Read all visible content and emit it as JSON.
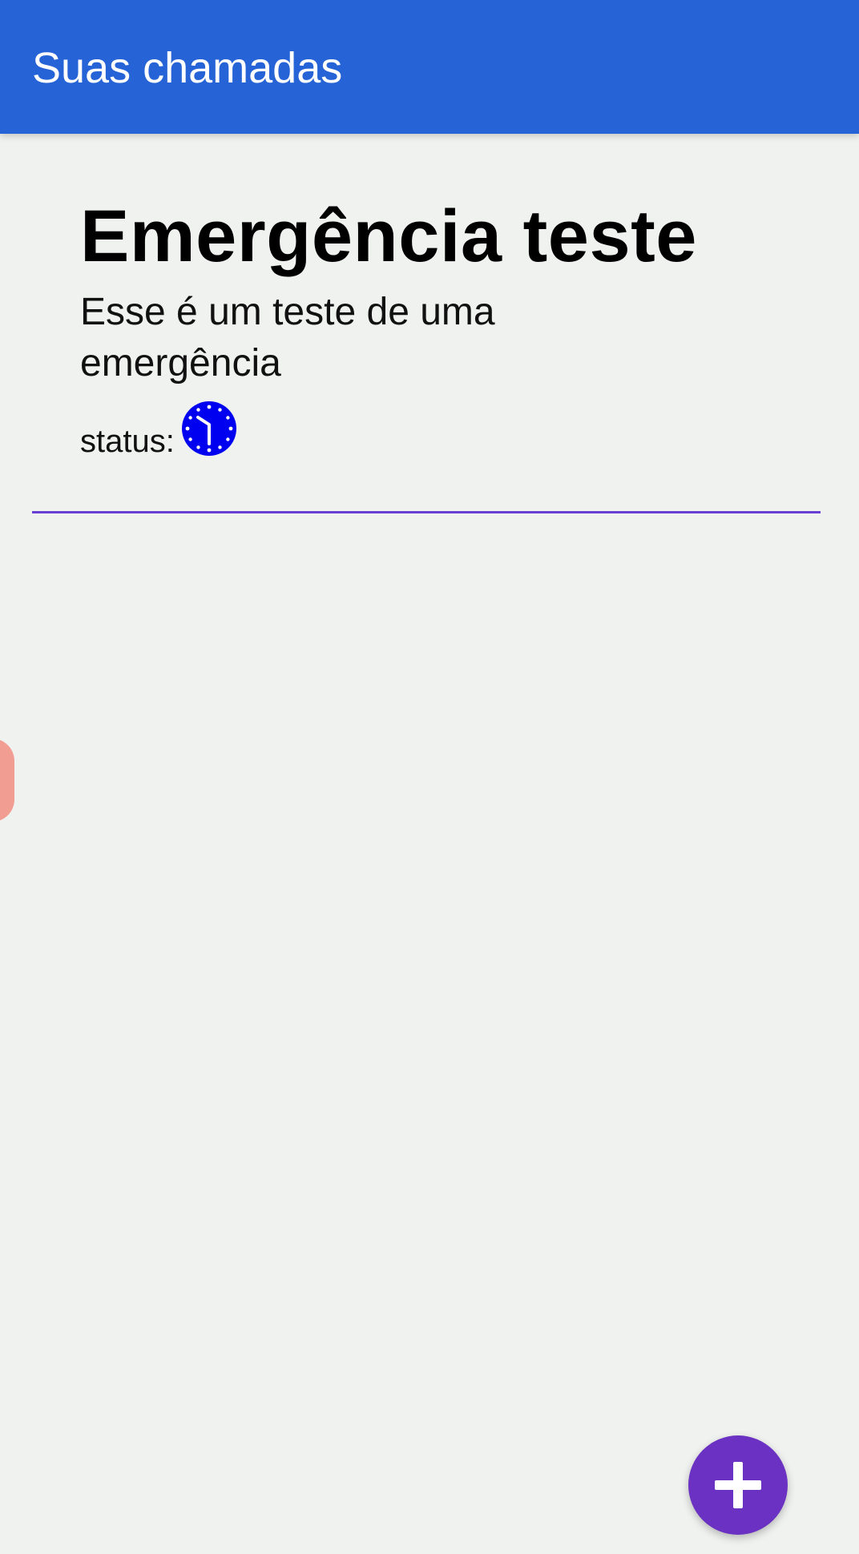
{
  "app_bar": {
    "title": "Suas chamadas",
    "color": "#2563d6"
  },
  "calls": [
    {
      "title": "Emergência teste",
      "description": "Esse é um teste de uma emergência",
      "status_label": "status:",
      "status_icon": "clock-icon",
      "status_color": "#0000f0"
    }
  ],
  "divider_color": "#6a3fd3",
  "fab": {
    "icon": "plus-icon",
    "color": "#6b31c2"
  }
}
